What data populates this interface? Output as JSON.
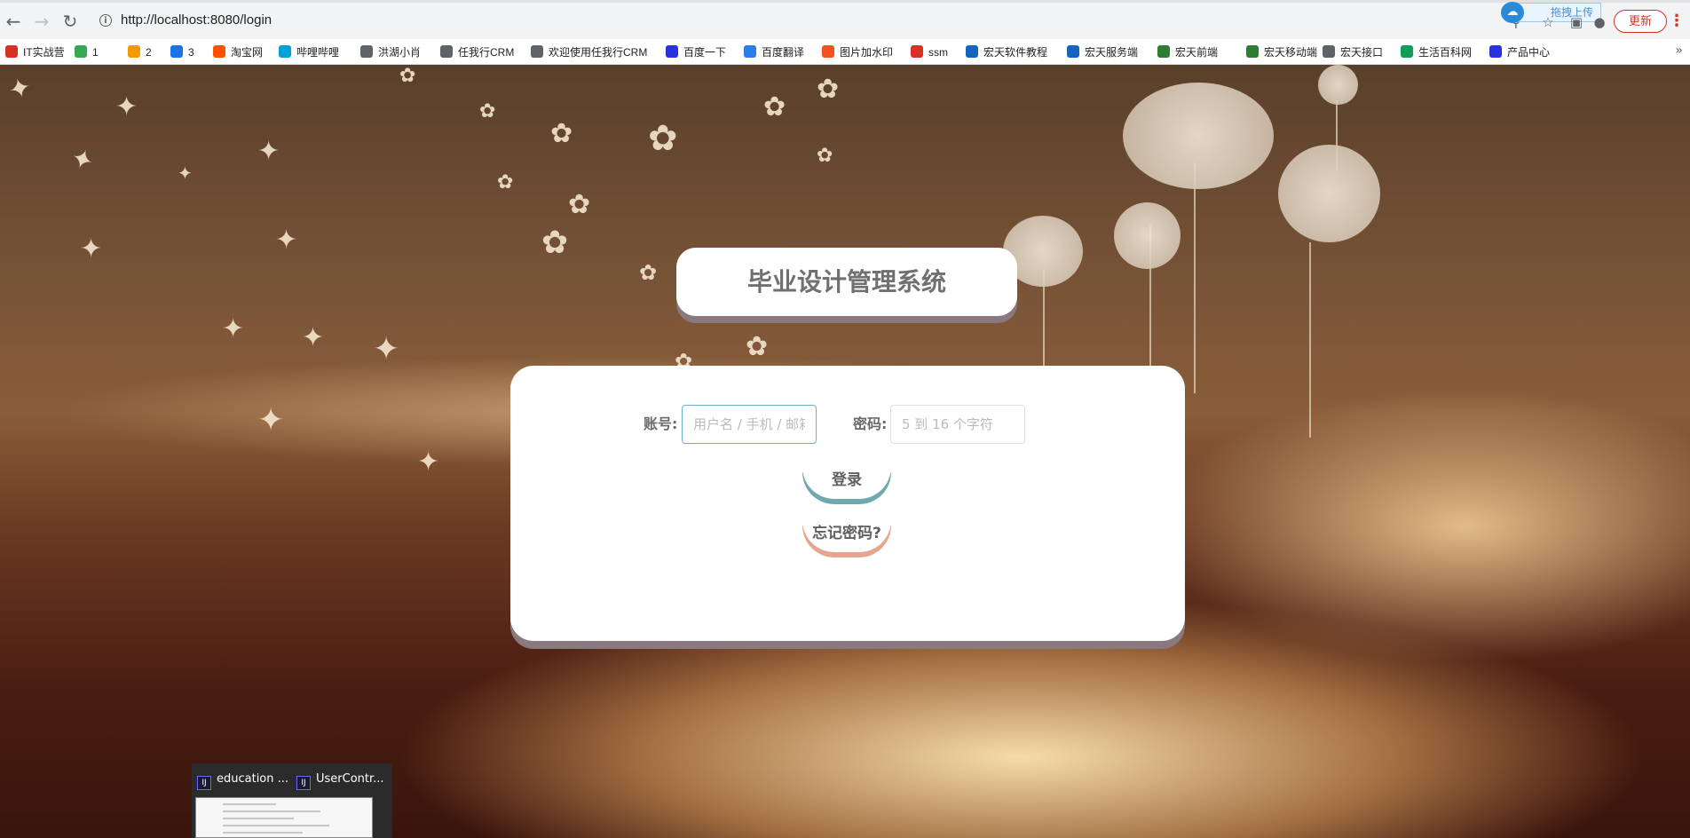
{
  "browser": {
    "url": "http://localhost:8080/login",
    "update_label": "更新",
    "upload_label": "拖拽上传"
  },
  "bookmarks": [
    {
      "label": "IT实战营",
      "icon": "chrome-red-icon",
      "color": "#d93025"
    },
    {
      "label": "1",
      "icon": "recycle-icon",
      "color": "#34a853"
    },
    {
      "label": "2",
      "icon": "orange-circle-icon",
      "color": "#f29900"
    },
    {
      "label": "3",
      "icon": "fish-icon",
      "color": "#1a73e8"
    },
    {
      "label": "淘宝网",
      "icon": "taobao-icon",
      "color": "#ff5000"
    },
    {
      "label": "哔哩哔哩",
      "icon": "bilibili-icon",
      "color": "#00a1d6"
    },
    {
      "label": "洪湖小肖",
      "icon": "feather-icon",
      "color": "#5f6368"
    },
    {
      "label": "任我行CRM",
      "icon": "globe-icon",
      "color": "#5f6368"
    },
    {
      "label": "欢迎使用任我行CRM",
      "icon": "globe-icon",
      "color": "#5f6368"
    },
    {
      "label": "百度一下",
      "icon": "baidu-paw-icon",
      "color": "#2932e1"
    },
    {
      "label": "百度翻译",
      "icon": "translate-icon",
      "color": "#2b7de9"
    },
    {
      "label": "图片加水印",
      "icon": "image-icon",
      "color": "#f4511e"
    },
    {
      "label": "ssm",
      "icon": "g-icon",
      "color": "#d93025"
    },
    {
      "label": "宏天软件教程",
      "icon": "h-logo-icon",
      "color": "#1565c0"
    },
    {
      "label": "宏天服务端",
      "icon": "h-logo-icon",
      "color": "#1565c0"
    },
    {
      "label": "宏天前端",
      "icon": "vue-icon",
      "color": "#2e7d32"
    },
    {
      "label": "宏天移动端",
      "icon": "vue-icon",
      "color": "#2e7d32"
    },
    {
      "label": "宏天接口",
      "icon": "globe-icon",
      "color": "#5f6368"
    },
    {
      "label": "生活百科网",
      "icon": "book-icon",
      "color": "#0f9d58"
    },
    {
      "label": "产品中心",
      "icon": "baidu-paw-icon",
      "color": "#2932e1"
    }
  ],
  "login": {
    "title": "毕业设计管理系统",
    "account_label": "账号:",
    "account_placeholder": "用户名 / 手机 / 邮箱",
    "password_label": "密码:",
    "password_placeholder": "5 到 16 个字符",
    "login_button": "登录",
    "forgot_button": "忘记密码?"
  },
  "taskbar_preview": {
    "items": [
      "education ...",
      "UserContr..."
    ]
  }
}
